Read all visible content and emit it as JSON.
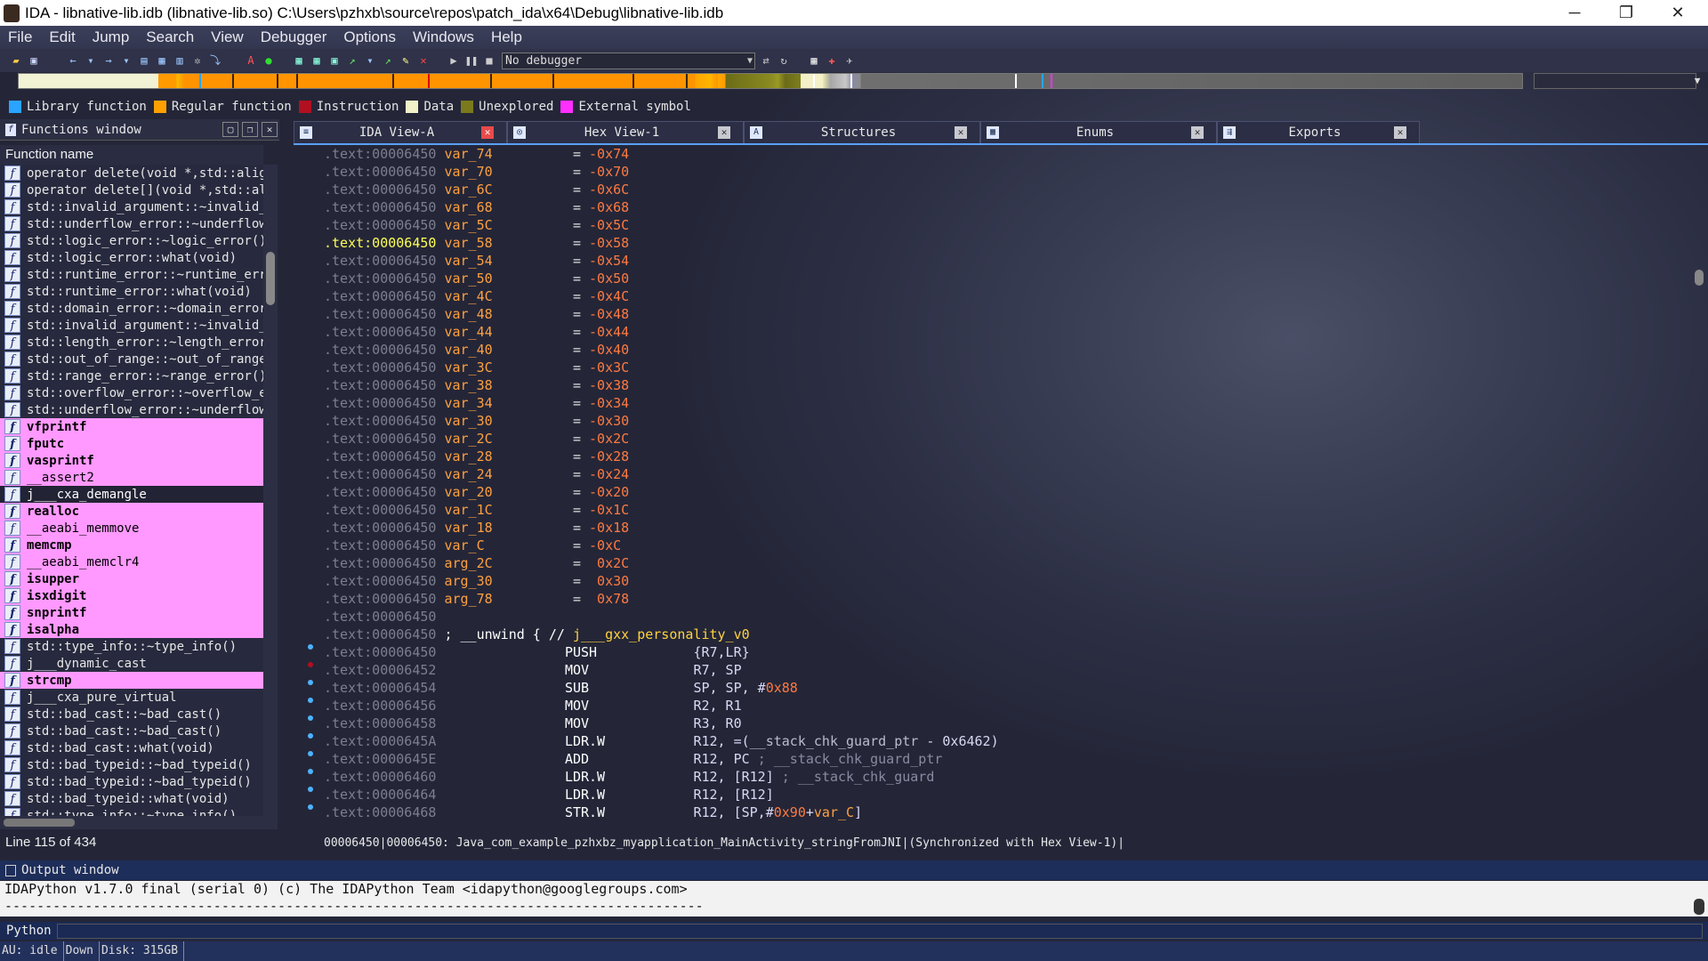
{
  "window": {
    "title": "IDA - libnative-lib.idb (libnative-lib.so) C:\\Users\\pzhxb\\source\\repos\\patch_ida\\x64\\Debug\\libnative-lib.idb",
    "minimize": "─",
    "maximize": "❐",
    "close": "✕"
  },
  "menu": [
    "File",
    "Edit",
    "Jump",
    "Search",
    "View",
    "Debugger",
    "Options",
    "Windows",
    "Help"
  ],
  "toolbar": {
    "debugger_select": "No debugger"
  },
  "legend": [
    {
      "label": "Library function",
      "color": "#2aa4ff"
    },
    {
      "label": "Regular function",
      "color": "#ffa000"
    },
    {
      "label": "Instruction",
      "color": "#b01020"
    },
    {
      "label": "Data",
      "color": "#f2f2c8"
    },
    {
      "label": "Unexplored",
      "color": "#7a7a1c"
    },
    {
      "label": "External symbol",
      "color": "#ff30ff"
    }
  ],
  "functions_window": {
    "title": "Functions window",
    "column": "Function name",
    "line_info": "Line 115 of 434",
    "items": [
      {
        "name": "operator delete(void *,std::align",
        "kind": "normal"
      },
      {
        "name": "operator delete[](void *,std::ali",
        "kind": "normal"
      },
      {
        "name": "std::invalid_argument::~invalid_a",
        "kind": "normal"
      },
      {
        "name": "std::underflow_error::~underflow_",
        "kind": "normal"
      },
      {
        "name": "std::logic_error::~logic_error()",
        "kind": "normal"
      },
      {
        "name": "std::logic_error::what(void)",
        "kind": "normal"
      },
      {
        "name": "std::runtime_error::~runtime_erro",
        "kind": "normal"
      },
      {
        "name": "std::runtime_error::what(void)",
        "kind": "normal"
      },
      {
        "name": "std::domain_error::~domain_error(",
        "kind": "normal"
      },
      {
        "name": "std::invalid_argument::~invalid_a",
        "kind": "normal"
      },
      {
        "name": "std::length_error::~length_error(",
        "kind": "normal"
      },
      {
        "name": "std::out_of_range::~out_of_range(",
        "kind": "normal"
      },
      {
        "name": "std::range_error::~range_error()",
        "kind": "normal"
      },
      {
        "name": "std::overflow_error::~overflow_er",
        "kind": "normal"
      },
      {
        "name": "std::underflow_error::~underflow_",
        "kind": "normal"
      },
      {
        "name": "vfprintf",
        "kind": "lib"
      },
      {
        "name": "fputc",
        "kind": "lib"
      },
      {
        "name": "vasprintf",
        "kind": "lib"
      },
      {
        "name": "__assert2",
        "kind": "libn"
      },
      {
        "name": "j___cxa_demangle",
        "kind": "sel"
      },
      {
        "name": "realloc",
        "kind": "lib"
      },
      {
        "name": "__aeabi_memmove",
        "kind": "libn"
      },
      {
        "name": "memcmp",
        "kind": "lib"
      },
      {
        "name": "__aeabi_memclr4",
        "kind": "libn"
      },
      {
        "name": "isupper",
        "kind": "lib"
      },
      {
        "name": "isxdigit",
        "kind": "lib"
      },
      {
        "name": "snprintf",
        "kind": "lib"
      },
      {
        "name": "isalpha",
        "kind": "lib"
      },
      {
        "name": "std::type_info::~type_info()",
        "kind": "normal"
      },
      {
        "name": "j___dynamic_cast",
        "kind": "normal"
      },
      {
        "name": "strcmp",
        "kind": "lib"
      },
      {
        "name": "j___cxa_pure_virtual",
        "kind": "normal"
      },
      {
        "name": "std::bad_cast::~bad_cast()",
        "kind": "normal"
      },
      {
        "name": "std::bad_cast::~bad_cast()",
        "kind": "normal"
      },
      {
        "name": "std::bad_cast::what(void)",
        "kind": "normal"
      },
      {
        "name": "std::bad_typeid::~bad_typeid()",
        "kind": "normal"
      },
      {
        "name": "std::bad_typeid::~bad_typeid()",
        "kind": "normal"
      },
      {
        "name": "std::bad_typeid::what(void)",
        "kind": "normal"
      },
      {
        "name": "std::type_info::~type_info()",
        "kind": "normal"
      }
    ]
  },
  "tabs": [
    {
      "label": "IDA View-A",
      "icon": "≡",
      "close": "red"
    },
    {
      "label": "Hex View-1",
      "icon": "◎",
      "close": "gray"
    },
    {
      "label": "Structures",
      "icon": "A",
      "close": "gray"
    },
    {
      "label": "Enums",
      "icon": "▦",
      "close": "gray"
    },
    {
      "label": "Exports",
      "icon": "⇶",
      "close": "gray"
    }
  ],
  "disasm": {
    "stack_vars": [
      {
        "addr": ".text:00006450",
        "name": "var_74",
        "val": "-0x74"
      },
      {
        "addr": ".text:00006450",
        "name": "var_70",
        "val": "-0x70"
      },
      {
        "addr": ".text:00006450",
        "name": "var_6C",
        "val": "-0x6C"
      },
      {
        "addr": ".text:00006450",
        "name": "var_68",
        "val": "-0x68"
      },
      {
        "addr": ".text:00006450",
        "name": "var_5C",
        "val": "-0x5C"
      },
      {
        "addr": ".text:00006450",
        "name": "var_58",
        "val": "-0x58",
        "current": true
      },
      {
        "addr": ".text:00006450",
        "name": "var_54",
        "val": "-0x54"
      },
      {
        "addr": ".text:00006450",
        "name": "var_50",
        "val": "-0x50"
      },
      {
        "addr": ".text:00006450",
        "name": "var_4C",
        "val": "-0x4C"
      },
      {
        "addr": ".text:00006450",
        "name": "var_48",
        "val": "-0x48"
      },
      {
        "addr": ".text:00006450",
        "name": "var_44",
        "val": "-0x44"
      },
      {
        "addr": ".text:00006450",
        "name": "var_40",
        "val": "-0x40"
      },
      {
        "addr": ".text:00006450",
        "name": "var_3C",
        "val": "-0x3C"
      },
      {
        "addr": ".text:00006450",
        "name": "var_38",
        "val": "-0x38"
      },
      {
        "addr": ".text:00006450",
        "name": "var_34",
        "val": "-0x34"
      },
      {
        "addr": ".text:00006450",
        "name": "var_30",
        "val": "-0x30"
      },
      {
        "addr": ".text:00006450",
        "name": "var_2C",
        "val": "-0x2C"
      },
      {
        "addr": ".text:00006450",
        "name": "var_28",
        "val": "-0x28"
      },
      {
        "addr": ".text:00006450",
        "name": "var_24",
        "val": "-0x24"
      },
      {
        "addr": ".text:00006450",
        "name": "var_20",
        "val": "-0x20"
      },
      {
        "addr": ".text:00006450",
        "name": "var_1C",
        "val": "-0x1C"
      },
      {
        "addr": ".text:00006450",
        "name": "var_18",
        "val": "-0x18"
      },
      {
        "addr": ".text:00006450",
        "name": "var_C",
        "val": "-0xC"
      },
      {
        "addr": ".text:00006450",
        "name": "arg_2C",
        "val": " 0x2C"
      },
      {
        "addr": ".text:00006450",
        "name": "arg_30",
        "val": " 0x30"
      },
      {
        "addr": ".text:00006450",
        "name": "arg_78",
        "val": " 0x78"
      }
    ],
    "blank_addr": ".text:00006450",
    "unwind": {
      "addr": ".text:00006450",
      "text": "; __unwind { // ",
      "label": "j___gxx_personality_v0"
    },
    "code": [
      {
        "addr": ".text:00006450",
        "mn": "PUSH",
        "ops": [
          {
            "t": "{R7,LR}",
            "c": "reg"
          }
        ]
      },
      {
        "addr": ".text:00006452",
        "mn": "MOV",
        "ops": [
          {
            "t": "R7, SP",
            "c": "reg"
          }
        ]
      },
      {
        "addr": ".text:00006454",
        "mn": "SUB",
        "ops": [
          {
            "t": "SP, SP, #",
            "c": "reg"
          },
          {
            "t": "0x88",
            "c": "n"
          }
        ]
      },
      {
        "addr": ".text:00006456",
        "mn": "MOV",
        "ops": [
          {
            "t": "R2, R1",
            "c": "reg"
          }
        ]
      },
      {
        "addr": ".text:00006458",
        "mn": "MOV",
        "ops": [
          {
            "t": "R3, R0",
            "c": "reg"
          }
        ]
      },
      {
        "addr": ".text:0000645A",
        "mn": "LDR.W",
        "ops": [
          {
            "t": "R12, =(",
            "c": "reg"
          },
          {
            "t": "__stack_chk_guard_ptr",
            "c": "dim"
          },
          {
            "t": " - 0x6462)",
            "c": "reg"
          }
        ]
      },
      {
        "addr": ".text:0000645E",
        "mn": "ADD",
        "ops": [
          {
            "t": "R12, PC ",
            "c": "reg"
          },
          {
            "t": "; __stack_chk_guard_ptr",
            "c": "cm"
          }
        ]
      },
      {
        "addr": ".text:00006460",
        "mn": "LDR.W",
        "ops": [
          {
            "t": "R12, [R12] ",
            "c": "reg"
          },
          {
            "t": "; __stack_chk_guard",
            "c": "cm"
          }
        ]
      },
      {
        "addr": ".text:00006464",
        "mn": "LDR.W",
        "ops": [
          {
            "t": "R12, [R12]",
            "c": "reg"
          }
        ]
      },
      {
        "addr": ".text:00006468",
        "mn": "STR.W",
        "ops": [
          {
            "t": "R12, [SP,#",
            "c": "reg"
          },
          {
            "t": "0x90",
            "c": "n"
          },
          {
            "t": "+",
            "c": "reg"
          },
          {
            "t": "var_C",
            "c": "v"
          },
          {
            "t": "]",
            "c": "reg"
          }
        ]
      }
    ],
    "status": "00006450|00006450: Java_com_example_pzhxbz_myapplication_MainActivity_stringFromJNI|(Synchronized with Hex View-1)|"
  },
  "output": {
    "title": "Output window",
    "line1": "IDAPython v1.7.0 final (serial 0) (c) The IDAPython Team <idapython@googlegroups.com>",
    "line2": "---------------------------------------------------------------------------------------",
    "prompt_label": "Python"
  },
  "statusbar": [
    "AU:  idle",
    "Down",
    "Disk: 315GB"
  ]
}
